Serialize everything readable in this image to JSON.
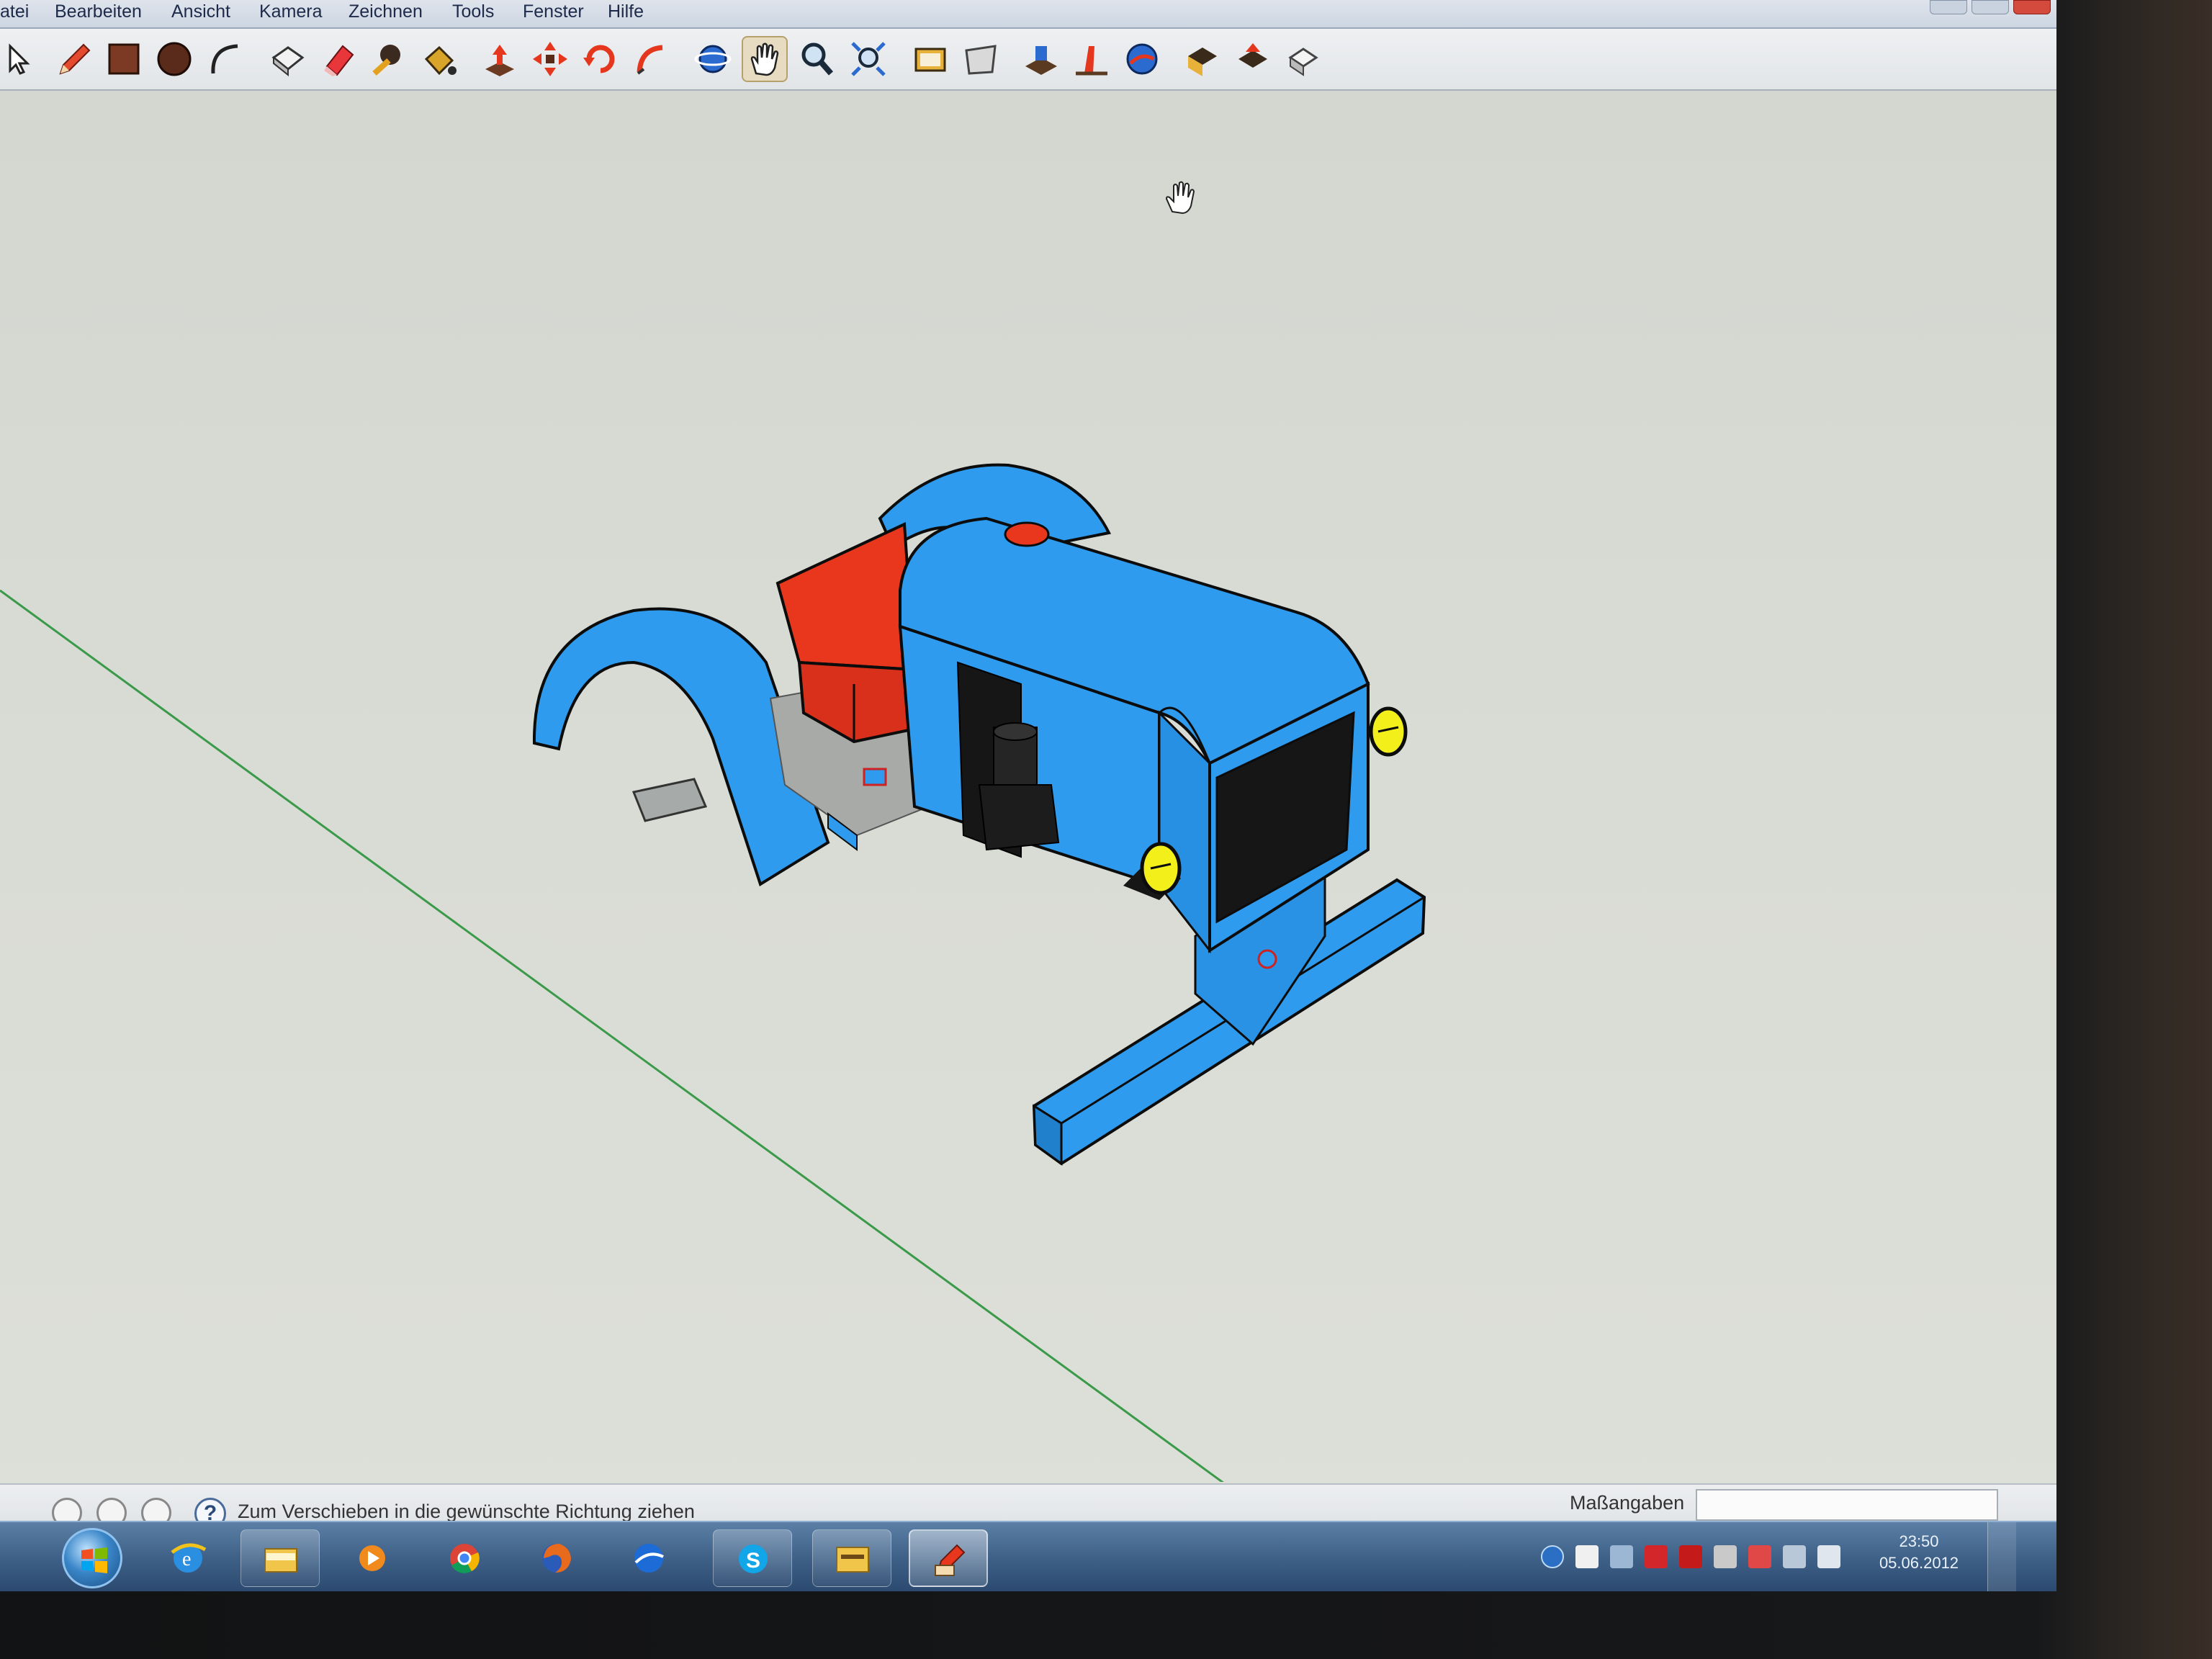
{
  "menu": {
    "items": [
      "atei",
      "Bearbeiten",
      "Ansicht",
      "Kamera",
      "Zeichnen",
      "Tools",
      "Fenster",
      "Hilfe"
    ]
  },
  "toolbar": {
    "tools": [
      "select-icon",
      "pencil-icon",
      "rectangle-icon",
      "circle-icon",
      "arc-icon",
      "make-component-icon",
      "eraser-icon",
      "tape-measure-icon",
      "paint-bucket-icon",
      "push-pull-icon",
      "move-icon",
      "rotate-icon",
      "follow-me-icon",
      "orbit-icon",
      "pan-icon",
      "zoom-icon",
      "zoom-extents-icon",
      "get-models-icon",
      "share-model-icon",
      "add-location-icon",
      "toggle-terrain-icon",
      "google-earth-icon",
      "get-models-warehouse-icon",
      "share-component-icon",
      "extension-warehouse-icon"
    ],
    "active_tool": "pan-icon"
  },
  "status": {
    "text": "Zum Verschieben in die gewünschte Richtung ziehen",
    "measurements_label": "Maßangaben",
    "measurements_value": ""
  },
  "taskbar": {
    "apps": [
      "internet-explorer-icon",
      "file-explorer-icon",
      "media-player-icon",
      "chrome-icon",
      "firefox-icon",
      "google-earth-icon",
      "skype-icon",
      "sketchup-folder-icon",
      "sketchup-icon"
    ],
    "active_app": "sketchup-icon",
    "clock_time": "23:50",
    "clock_date": "05.06.2012"
  },
  "colors": {
    "model_blue": "#2e9bee",
    "seat_red": "#e8371c",
    "headlight_yellow": "#f2ef1b",
    "grille_black": "#161616",
    "axis_green": "#3a9a4a"
  }
}
